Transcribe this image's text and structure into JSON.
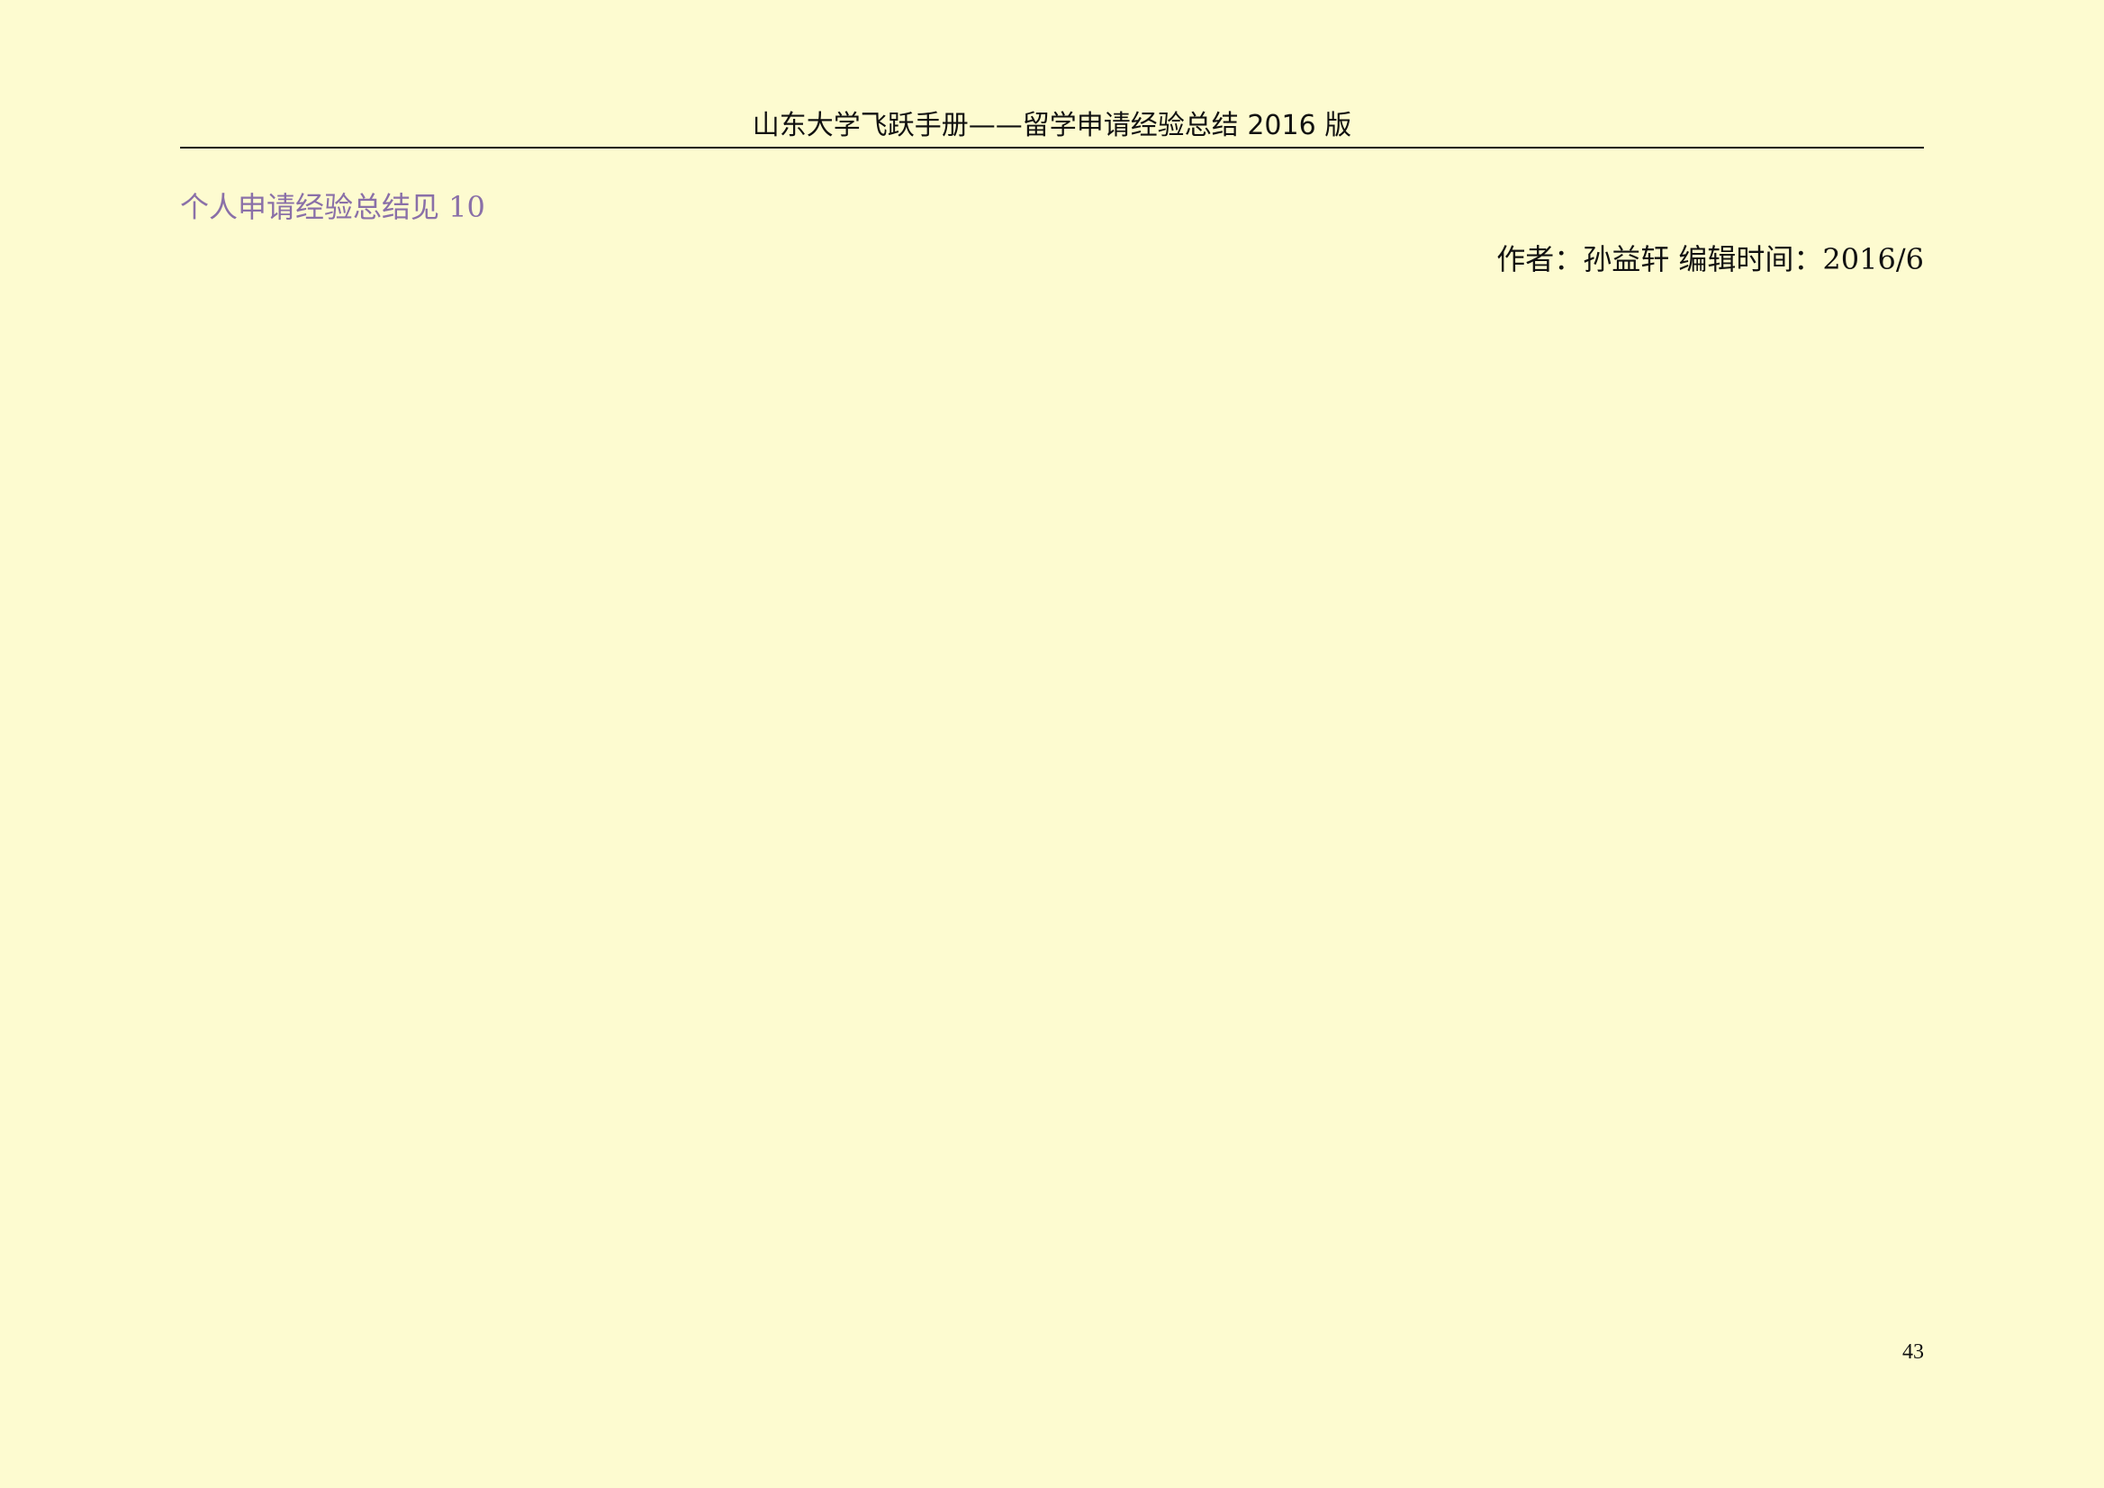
{
  "header": {
    "running_title": "山东大学飞跃手册——留学申请经验总结 2016 版"
  },
  "section": {
    "title": "个人申请经验总结见 10",
    "title_color": "#8a70a8"
  },
  "byline": {
    "text": "作者：孙益轩  编辑时间：2016/6"
  },
  "footer": {
    "page_number": "43"
  }
}
